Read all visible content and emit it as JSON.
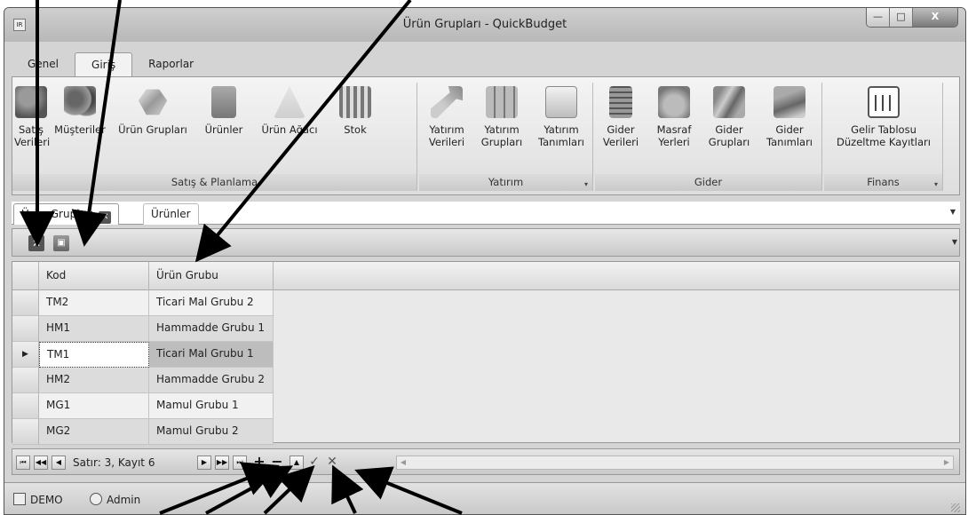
{
  "window": {
    "title": "Ürün Grupları - QuickBudget",
    "app_icon_text": "IR",
    "caption_buttons": {
      "minimize": "—",
      "maximize": "□",
      "close": "X"
    }
  },
  "ribbon": {
    "tabs": [
      {
        "label": "Genel"
      },
      {
        "label": "Giriş",
        "active": true
      },
      {
        "label": "Raporlar"
      }
    ],
    "groups": [
      {
        "caption": "Satış & Planlama",
        "buttons": [
          {
            "label": "Satış Verileri",
            "icon": "sales-data-icon"
          },
          {
            "label": "Müşteriler",
            "icon": "customers-icon"
          },
          {
            "label": "Ürün Grupları",
            "icon": "product-groups-icon"
          },
          {
            "label": "Ürünler",
            "icon": "products-icon"
          },
          {
            "label": "Ürün Ağacı",
            "icon": "product-tree-icon"
          },
          {
            "label": "Stok",
            "icon": "stock-icon"
          }
        ]
      },
      {
        "caption": "Yatırım",
        "buttons": [
          {
            "label": "Yatırım Verileri",
            "icon": "investment-data-icon"
          },
          {
            "label": "Yatırım Grupları",
            "icon": "investment-groups-icon"
          },
          {
            "label": "Yatırım Tanımları",
            "icon": "investment-definitions-icon"
          }
        ]
      },
      {
        "caption": "Gider",
        "buttons": [
          {
            "label": "Gider Verileri",
            "icon": "expense-data-icon"
          },
          {
            "label": "Masraf Yerleri",
            "icon": "cost-centers-icon"
          },
          {
            "label": "Gider Grupları",
            "icon": "expense-groups-icon"
          },
          {
            "label": "Gider Tanımları",
            "icon": "expense-definitions-icon"
          }
        ]
      },
      {
        "caption": "Finans",
        "buttons": [
          {
            "label": "Gelir Tablosu Düzeltme Kayıtları",
            "icon": "income-statement-adjustments-icon"
          }
        ]
      }
    ]
  },
  "doc_tabs": [
    {
      "label": "Ürün Grupları",
      "closable": true,
      "active": true
    },
    {
      "label": "Ürünler",
      "closable": false
    }
  ],
  "toolbar": {
    "close_icon": "close-icon",
    "save_icon": "save-icon"
  },
  "grid": {
    "columns": [
      "Kod",
      "Ürün Grubu"
    ],
    "rows": [
      {
        "kod": "TM2",
        "grup": "Ticari Mal Grubu 2"
      },
      {
        "kod": "HM1",
        "grup": "Hammadde Grubu 1"
      },
      {
        "kod": "TM1",
        "grup": "Ticari Mal Grubu 1",
        "current": true
      },
      {
        "kod": "HM2",
        "grup": "Hammadde Grubu 2"
      },
      {
        "kod": "MG1",
        "grup": "Mamul Grubu 1"
      },
      {
        "kod": "MG2",
        "grup": "Mamul Grubu 2"
      }
    ]
  },
  "navigator": {
    "info": "Satır: 3, Kayıt 6",
    "buttons": [
      "first",
      "prev-page",
      "prev",
      "next",
      "next-page",
      "last",
      "append",
      "delete",
      "edit",
      "end-edit",
      "cancel-edit"
    ]
  },
  "status": {
    "company": "DEMO",
    "user": "Admin"
  }
}
